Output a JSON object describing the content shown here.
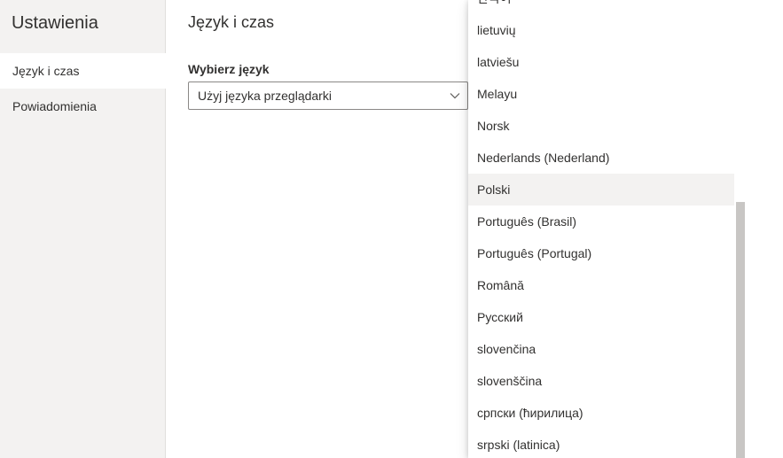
{
  "sidebar": {
    "title": "Ustawienia",
    "items": [
      {
        "label": "Język i czas",
        "active": true
      },
      {
        "label": "Powiadomienia",
        "active": false
      }
    ]
  },
  "main": {
    "title": "Język i czas",
    "language_label": "Wybierz język",
    "language_value": "Użyj języka przeglądarki"
  },
  "language_list": {
    "items": [
      "한국어",
      "lietuvių",
      "latviešu",
      "Melayu",
      "Norsk",
      "Nederlands (Nederland)",
      "Polski",
      "Português (Brasil)",
      "Português (Portugal)",
      "Română",
      "Русский",
      "slovenčina",
      "slovenščina",
      "српски (ћирилица)",
      "srpski (latinica)"
    ],
    "highlighted": "Polski"
  },
  "icons": {
    "dropdown_chevron": "chevron-down-icon"
  },
  "colors": {
    "sidebar_bg": "#f3f2f1",
    "highlight_bg": "#f3f2f1",
    "text": "#323130",
    "scroll_thumb": "#c8c6c4"
  }
}
